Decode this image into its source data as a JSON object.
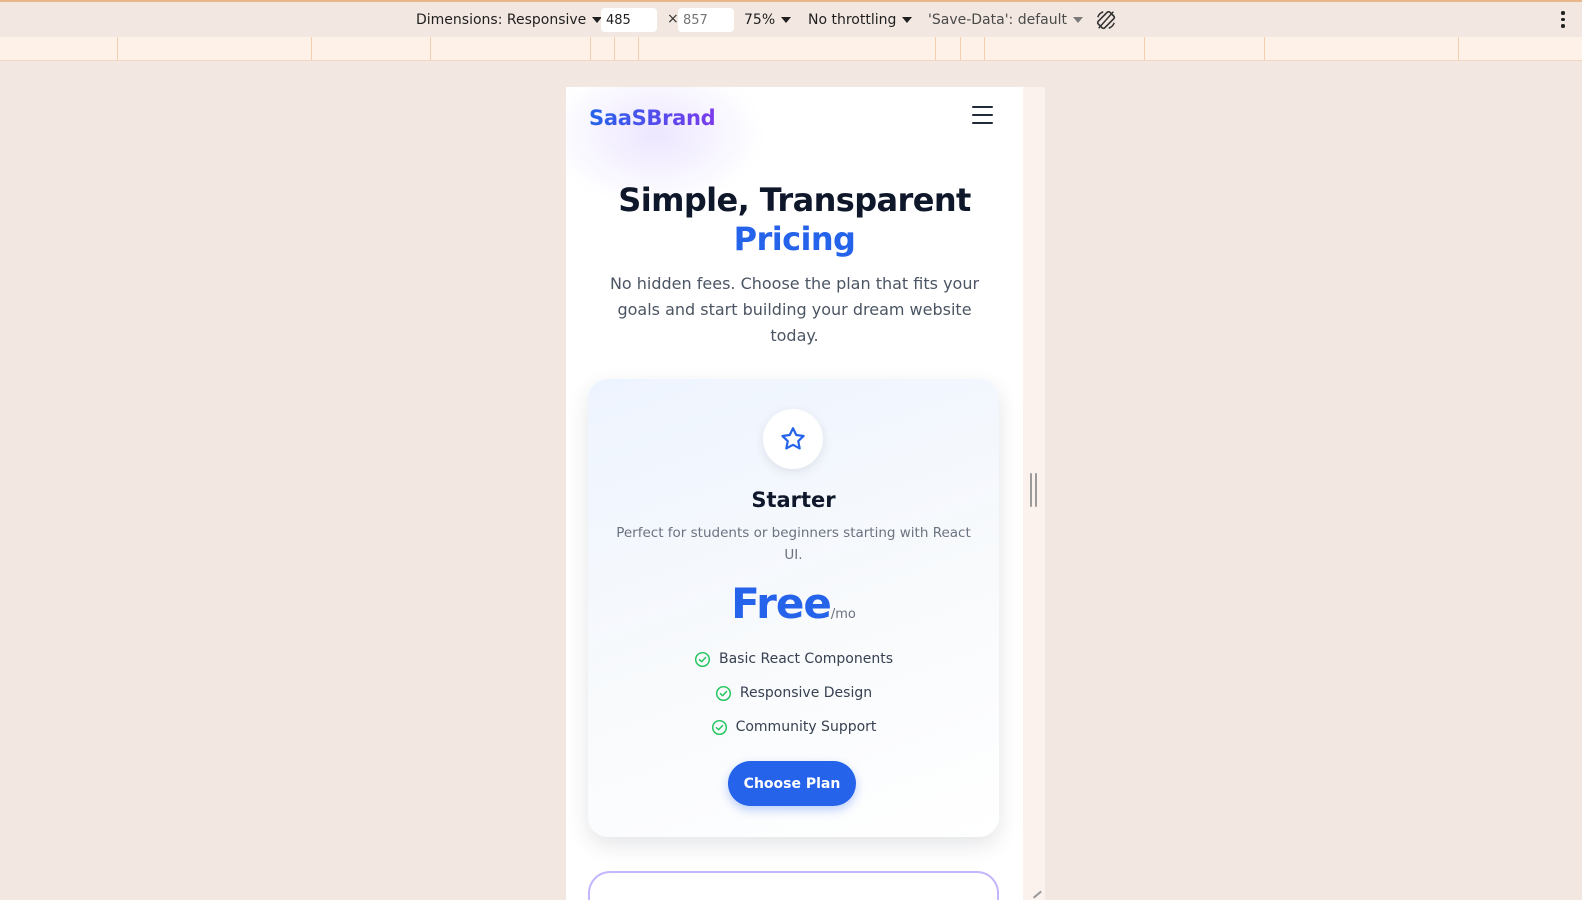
{
  "devtools": {
    "dimensions_label": "Dimensions: Responsive",
    "width_value": "485",
    "height_placeholder": "857",
    "times": "×",
    "zoom": "75%",
    "throttling": "No throttling",
    "save_data": "'Save-Data': default"
  },
  "page": {
    "brand": "SaaSBrand",
    "hero": {
      "title_line1": "Simple, Transparent",
      "title_accent": "Pricing",
      "subtitle": "No hidden fees. Choose the plan that fits your goals and start building your dream website today."
    },
    "plan": {
      "icon": "star-icon",
      "name": "Starter",
      "description": "Perfect for students or beginners starting with React UI.",
      "price": "Free",
      "period": "/mo",
      "features": [
        "Basic React Components",
        "Responsive Design",
        "Community Support"
      ],
      "cta": "Choose Plan"
    }
  },
  "colors": {
    "primary": "#2563eb",
    "brand_gradient_end": "#7c3aed",
    "check_green": "#22c55e",
    "toolbar_bg": "#f3e8e1"
  }
}
